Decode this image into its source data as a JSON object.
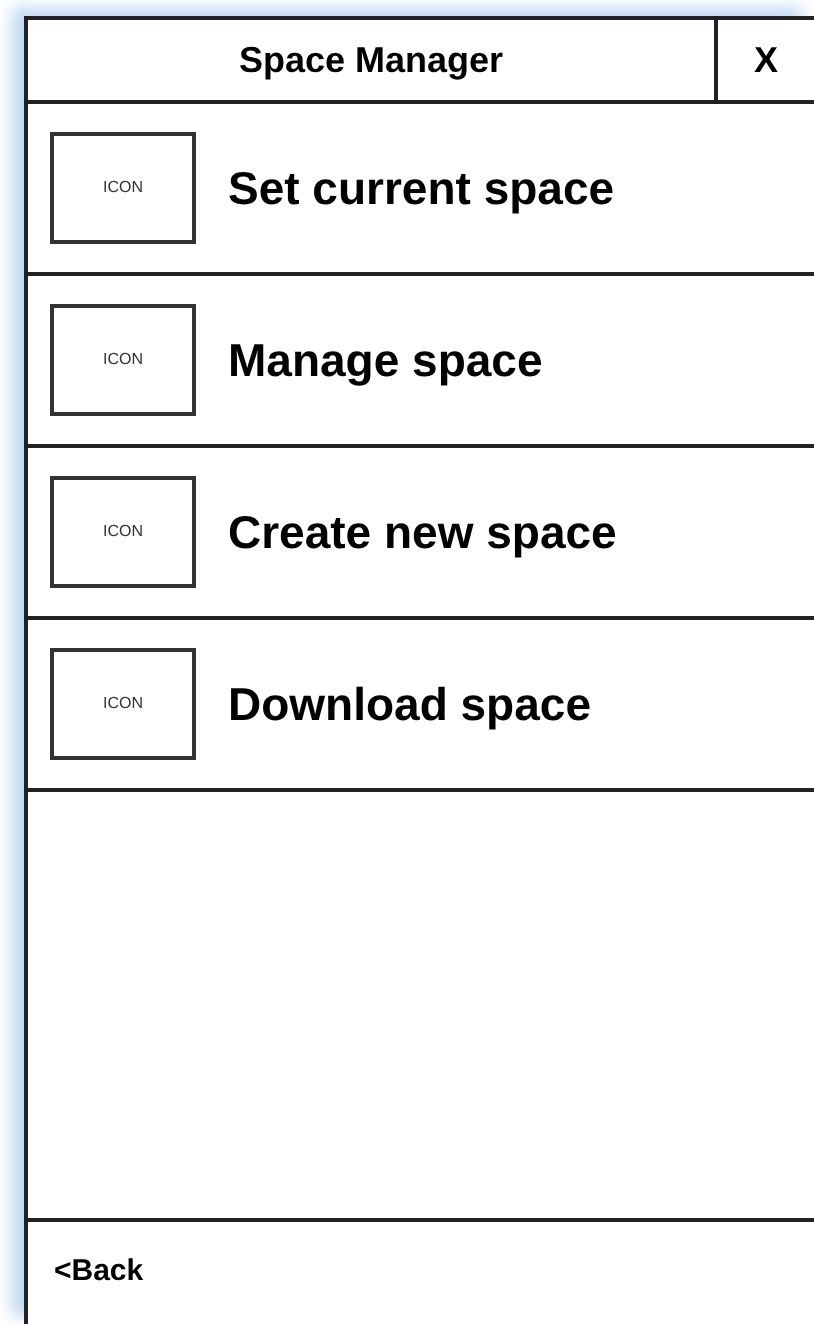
{
  "window": {
    "title": "Space Manager",
    "close": "X"
  },
  "items": [
    {
      "icon": "ICON",
      "label": "Set current space"
    },
    {
      "icon": "ICON",
      "label": "Manage space"
    },
    {
      "icon": "ICON",
      "label": "Create new space"
    },
    {
      "icon": "ICON",
      "label": "Download space"
    }
  ],
  "footer": {
    "back": "<Back"
  }
}
